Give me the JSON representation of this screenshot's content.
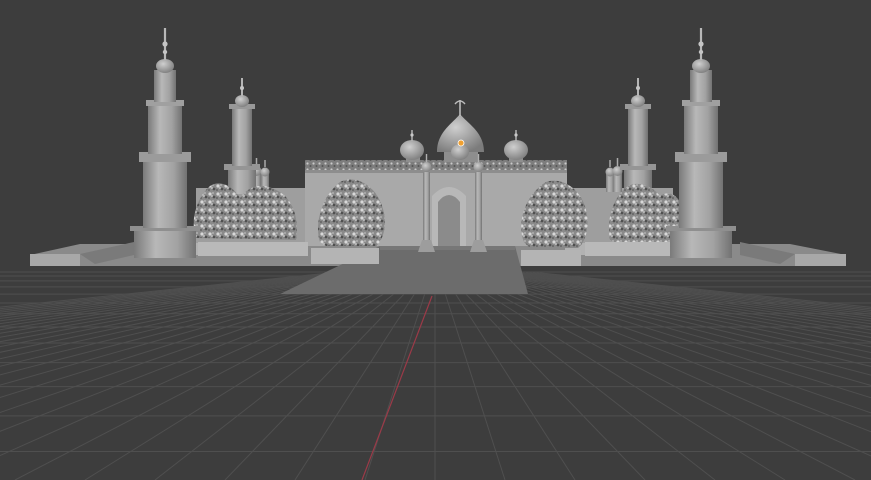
{
  "viewport": {
    "mode": "solid-shading",
    "background_color": "#3d3d3d",
    "grid_color": "#4f4f4f",
    "x_axis_color": "#9b3a48"
  },
  "scene": {
    "objects": [
      "ground-plaza",
      "walkway",
      "mosque-facade",
      "center-dome",
      "side-domes",
      "entrance-arch",
      "entrance-columns",
      "minaret-outer-left",
      "minaret-inner-left",
      "minaret-inner-right",
      "minaret-outer-right",
      "tree-clusters",
      "planters"
    ],
    "origin_marker_color": "#f0a030",
    "material_base_color": "#9a9a9a"
  }
}
